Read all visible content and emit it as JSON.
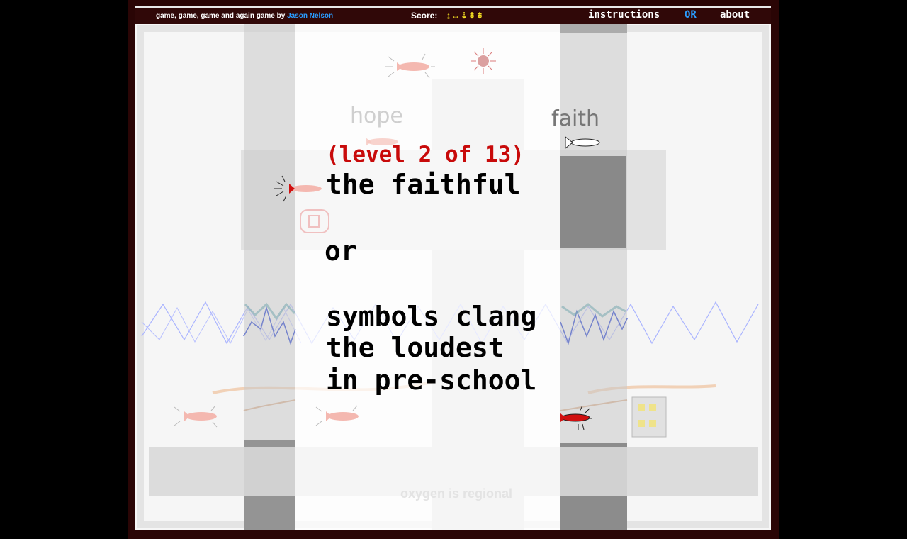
{
  "header": {
    "title": "game, game, game and again game",
    "by": "by",
    "author": "Jason Nelson",
    "score_label": "Score:",
    "score_value": "↨↔⇣⇟⇟",
    "nav": {
      "instructions": "instructions",
      "or": "OR",
      "about": "about"
    }
  },
  "level": {
    "caption": "(level 2 of 13)",
    "lines": [
      "the faithful",
      "or",
      "symbols clang",
      "the loudest",
      "in pre-school"
    ]
  },
  "scene": {
    "faith_word": "faith",
    "hope_word": "hope",
    "footer_text": "oxygen is regional"
  },
  "colors": {
    "frame": "#2a0505",
    "header_bg": "#300808",
    "level_red": "#c80a0a",
    "score_yellow": "#f2dd22",
    "link_blue": "#2a9cff",
    "wave_blue": "#1030d0"
  },
  "sprites": [
    "rocket-icon",
    "sun-icon",
    "spiky-rocket-icon",
    "building-icon",
    "wave-line"
  ]
}
